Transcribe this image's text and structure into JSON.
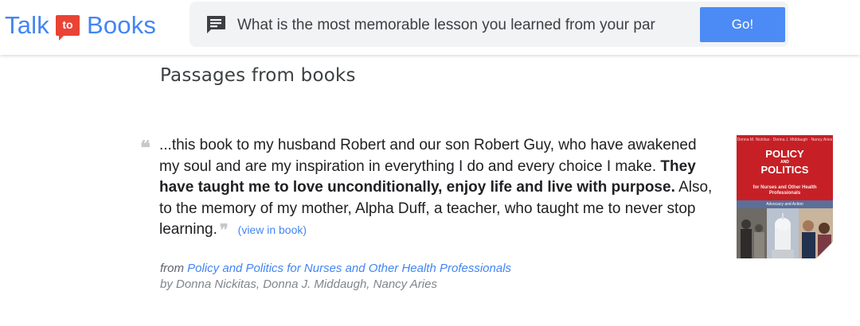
{
  "header": {
    "logo": {
      "word_left": "Talk",
      "badge": "to",
      "word_right": "Books"
    },
    "search": {
      "query": "What is the most memorable lesson you learned from your par",
      "icon": "chat-bubble-icon"
    },
    "go_label": "Go!"
  },
  "results": {
    "section_title": "Passages from books",
    "passage": {
      "text_before": "...this book to my husband Robert and our son Robert Guy, who have awakened my soul and are my inspiration in everything I do and every choice I make. ",
      "text_bold": "They have taught me to love unconditionally, enjoy life and live with purpose.",
      "text_after": " Also, to the memory of my mother, Alpha Duff, a teacher, who taught me to never stop learning.",
      "view_link": "(view in book)"
    },
    "source": {
      "from_label": "from",
      "book_title": "Policy and Politics for Nurses and Other Health Professionals",
      "authors": "by Donna Nickitas, Donna J. Middaugh, Nancy Aries"
    },
    "cover": {
      "authors": "Donna M. Nickitas · Donna J. Middaugh · Nancy Aries",
      "title_line1": "POLICY",
      "title_and": "AND",
      "title_line2": "POLITICS",
      "subtitle": "for Nurses and Other Health Professionals",
      "band": "Advocacy and Action",
      "color": "#c62026"
    }
  }
}
